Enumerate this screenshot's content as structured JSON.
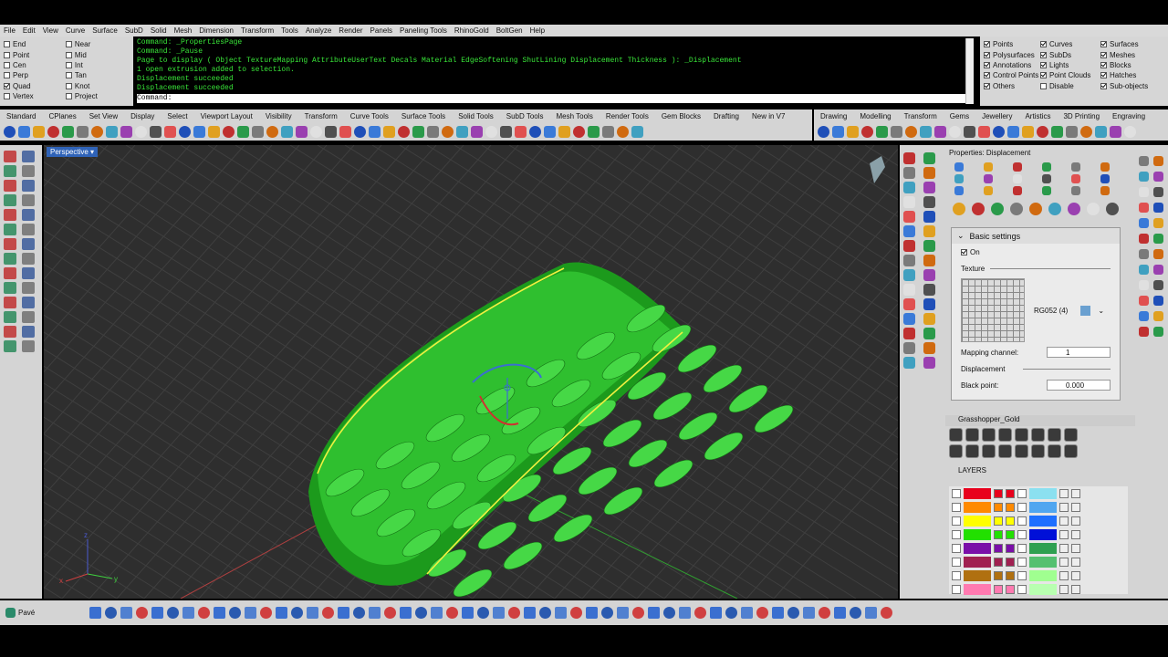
{
  "menu": [
    "File",
    "Edit",
    "View",
    "Curve",
    "Surface",
    "SubD",
    "Solid",
    "Mesh",
    "Dimension",
    "Transform",
    "Tools",
    "Analyze",
    "Render",
    "Panels",
    "Paneling Tools",
    "RhinoGold",
    "BoltGen",
    "Help"
  ],
  "osnap": [
    {
      "label": "End",
      "on": false
    },
    {
      "label": "Point",
      "on": false
    },
    {
      "label": "Cen",
      "on": false
    },
    {
      "label": "Perp",
      "on": false
    },
    {
      "label": "Quad",
      "on": true
    },
    {
      "label": "Vertex",
      "on": false
    },
    {
      "label": "Near",
      "on": false
    },
    {
      "label": "Mid",
      "on": false
    },
    {
      "label": "Int",
      "on": false
    },
    {
      "label": "Tan",
      "on": false
    },
    {
      "label": "Knot",
      "on": false
    },
    {
      "label": "Project",
      "on": false
    }
  ],
  "command_history": [
    "Command: _PropertiesPage",
    "Command: _Pause",
    "Page to display ( Object  TextureMapping  AttributeUserText  Decals  Material  EdgeSoftening  ShutLining  Displacement  Thickness ): _Displacement",
    "1 open extrusion added to selection.",
    "Displacement succeeded",
    "Displacement succeeded"
  ],
  "command_prompt": "Command:",
  "filter": [
    {
      "label": "Points",
      "on": true
    },
    {
      "label": "Polysurfaces",
      "on": true
    },
    {
      "label": "Annotations",
      "on": true
    },
    {
      "label": "Control Points",
      "on": true
    },
    {
      "label": "Others",
      "on": true
    },
    {
      "label": "Curves",
      "on": true
    },
    {
      "label": "SubDs",
      "on": true
    },
    {
      "label": "Lights",
      "on": true
    },
    {
      "label": "Point Clouds",
      "on": true
    },
    {
      "label": "Disable",
      "on": false
    },
    {
      "label": "Surfaces",
      "on": true
    },
    {
      "label": "Meshes",
      "on": true
    },
    {
      "label": "Blocks",
      "on": true
    },
    {
      "label": "Hatches",
      "on": true
    },
    {
      "label": "Sub-objects",
      "on": true
    }
  ],
  "toolbar_tabs_left": [
    "Standard",
    "CPlanes",
    "Set View",
    "Display",
    "Select",
    "Viewport Layout",
    "Visibility",
    "Transform",
    "Curve Tools",
    "Surface Tools",
    "Solid Tools",
    "SubD Tools",
    "Mesh Tools",
    "Render Tools",
    "Gem Blocks",
    "Drafting",
    "New in V7"
  ],
  "toolbar_tabs_right": [
    "Drawing",
    "Modelling",
    "Transform",
    "Gems",
    "Jewellery",
    "Artistics",
    "3D Printing",
    "Engraving"
  ],
  "viewport": {
    "label": "Perspective"
  },
  "properties": {
    "title": "Properties: Displacement",
    "section": "Basic settings",
    "on_label": "On",
    "texture_label": "Texture",
    "texture_name": "RG052 (4)",
    "mapping_channel_label": "Mapping channel:",
    "mapping_channel_value": "1",
    "displacement_label": "Displacement",
    "black_point_label": "Black point:",
    "black_point_value": "0.000"
  },
  "grasshopper": {
    "title": "Grasshopper_Gold"
  },
  "layers": {
    "title": "LAYERS",
    "rows": [
      {
        "a": "#e8001c",
        "b": "#e8001c",
        "c": "#8be0f0"
      },
      {
        "a": "#ff8a00",
        "b": "#ff8a00",
        "c": "#50a6f0"
      },
      {
        "a": "#ffff00",
        "b": "#ffff00",
        "c": "#1e6fff"
      },
      {
        "a": "#22e000",
        "b": "#22e000",
        "c": "#0010d8"
      },
      {
        "a": "#7a0fa8",
        "b": "#7a0fa8",
        "c": "#2fa050"
      },
      {
        "a": "#a02050",
        "b": "#a02050",
        "c": "#55c070"
      },
      {
        "a": "#b07010",
        "b": "#b07010",
        "c": "#a0ff90"
      },
      {
        "a": "#ff7ab0",
        "b": "#ff7ab0",
        "c": "#b8ffb0"
      }
    ]
  },
  "status": {
    "cplane_tag": "Pavé"
  },
  "colors": {
    "model": "#20b020",
    "edge": "#f0f040",
    "grid": "#3b3b3b",
    "bg": "#2e2e2e"
  }
}
